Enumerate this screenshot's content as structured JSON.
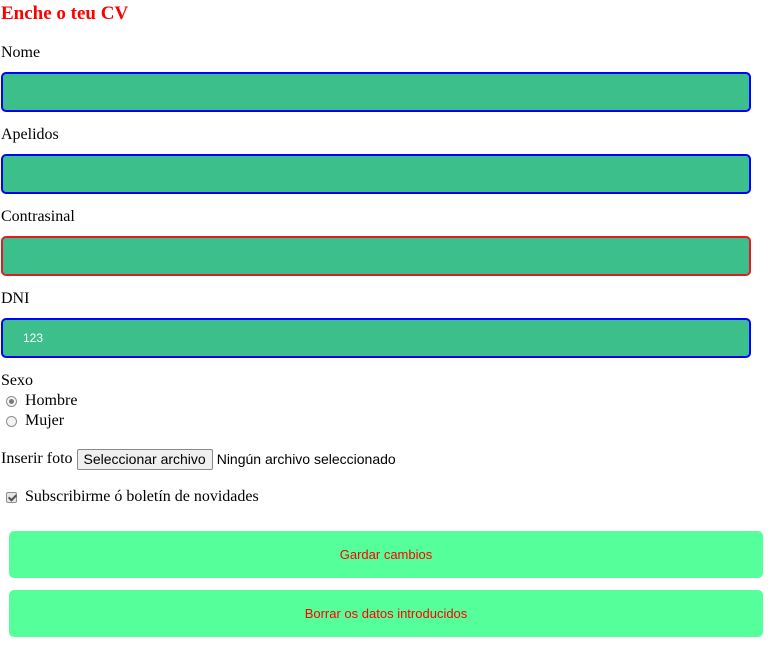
{
  "title": "Enche o teu CV",
  "fields": {
    "nome": {
      "label": "Nome",
      "value": ""
    },
    "apelidos": {
      "label": "Apelidos",
      "value": ""
    },
    "contrasinal": {
      "label": "Contrasinal",
      "value": ""
    },
    "dni": {
      "label": "DNI",
      "value": "123"
    }
  },
  "sexo": {
    "label": "Sexo",
    "options": [
      {
        "label": "Hombre",
        "checked": true
      },
      {
        "label": "Mujer",
        "checked": false
      }
    ]
  },
  "foto": {
    "label": "Inserir foto",
    "button_label": "Seleccionar archivo",
    "status": "Ningún archivo seleccionado"
  },
  "subscribe": {
    "label": "Subscribirme ó boletín de novidades",
    "checked": true
  },
  "buttons": {
    "save": "Gardar cambios",
    "reset": "Borrar os datos introducidos"
  },
  "colors": {
    "title": "#ff0000",
    "field_bg": "#3dbf8c",
    "field_border": "#0000ff",
    "field_border_invalid": "#e21c1c",
    "button_bg": "#55ff99",
    "button_text": "#ff0000"
  }
}
